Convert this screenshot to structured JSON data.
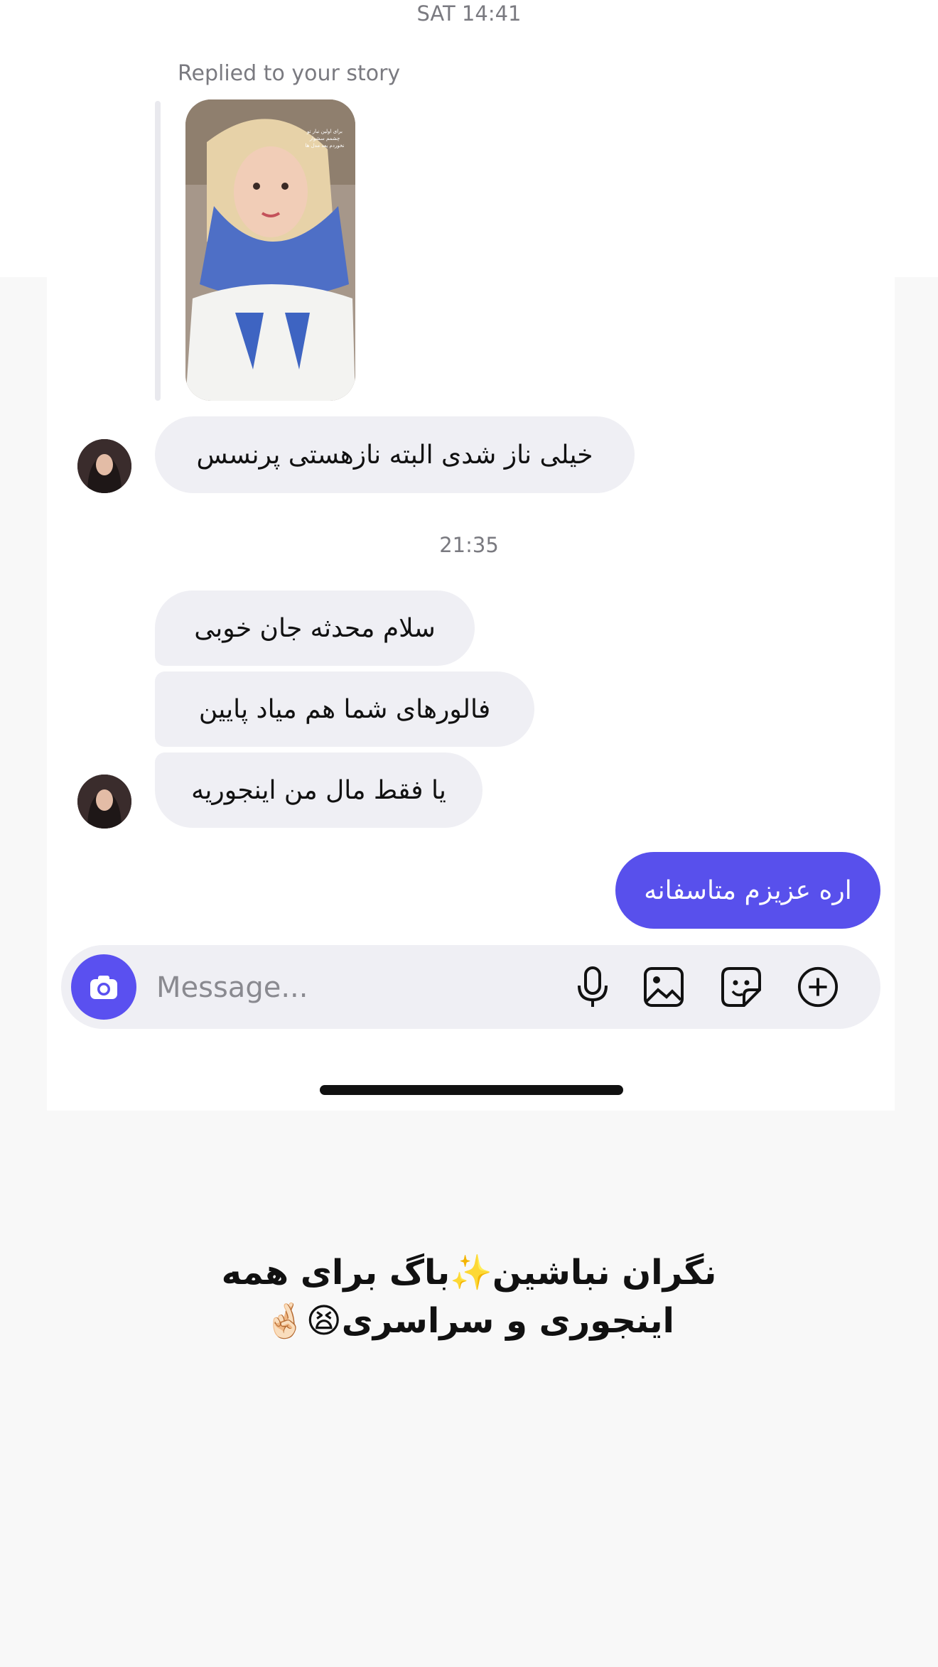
{
  "chat": {
    "timestamp_top": "SAT 14:41",
    "replied_label": "Replied to your story",
    "story_overlay": "برای اولین نبار تو چشمم سشوار نخوردم یعد مدل ها",
    "msg1": "خیلی ناز شدی البته نازهستی پرنسس",
    "timestamp_mid": "21:35",
    "msg2": "سلام محدثه جان خوبی",
    "msg3": "فالورهای شما هم میاد پایین",
    "msg4": "یا فقط مال من اینجوریه",
    "msg_out": "اره عزیزم متاسفانه"
  },
  "composer": {
    "placeholder": "Message...",
    "icons": [
      "camera-icon",
      "microphone-icon",
      "gallery-icon",
      "sticker-icon",
      "add-icon"
    ]
  },
  "caption": {
    "line1_a": "نگران نباشین",
    "line1_emoji": "✨",
    "line1_b": "باگ برای همه",
    "line2_text": "اینجوری و سراسری",
    "line2_emoji": "😫🤞🏻"
  },
  "colors": {
    "accent": "#5850ec",
    "incoming_bubble": "#efeff4",
    "background": "#f8f8f8"
  }
}
